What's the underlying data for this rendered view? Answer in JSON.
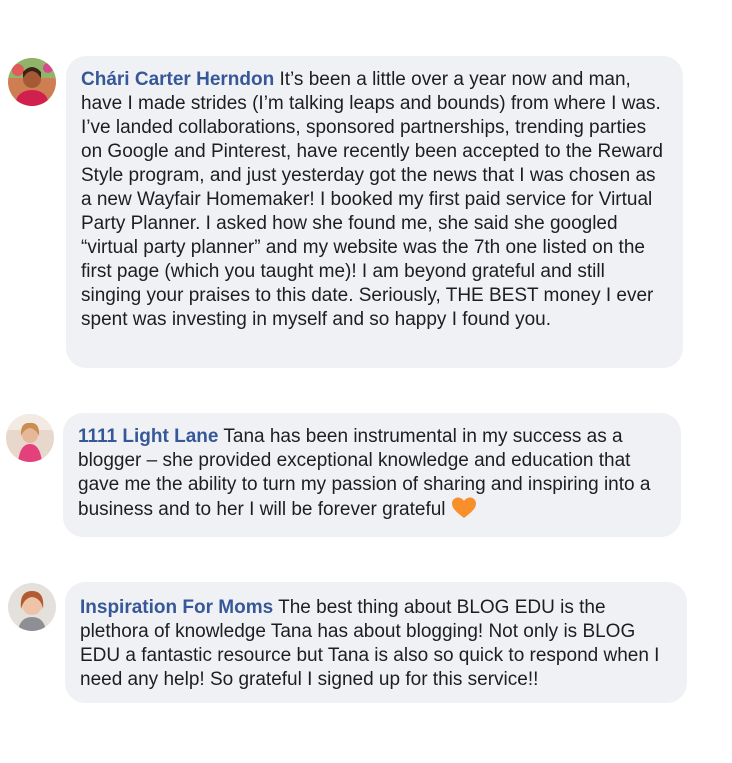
{
  "comments": [
    {
      "author": "Chári Carter Herndon",
      "text": "It’s been a little over a year now and man, have I made strides (I’m talking leaps and bounds) from where I was. I’ve landed collaborations, sponsored partnerships, trending parties on Google and Pinterest, have recently been accepted to the Reward Style program, and just yesterday got the news that I was chosen as a new Wayfair Homemaker! I booked my first paid service for Virtual Party Planner. I asked how she found me, she said she googled “virtual party planner” and my website was the 7th one listed on the first page (which you taught me)! I am beyond grateful and still singing your praises to this date. Seriously, THE BEST money I ever spent was investing in myself and so happy I found you.",
      "avatar_icon": "profile-photo-icon"
    },
    {
      "author": "1111 Light Lane",
      "text": "Tana has been instrumental in my success as a blogger – she provided exceptional knowledge and education that gave me the ability to turn my passion of sharing and inspiring into a business and to her I will be forever grateful",
      "emoji": "orange-heart-icon",
      "avatar_icon": "profile-photo-icon"
    },
    {
      "author": "Inspiration For Moms",
      "text": "The best thing about BLOG EDU is the plethora of knowledge Tana has about blogging! Not only is BLOG EDU a fantastic resource but Tana is also so quick to respond when I need any help! So grateful I signed up for this service!!",
      "avatar_icon": "profile-photo-icon"
    }
  ],
  "colors": {
    "bubble_background": "#f0f1f4",
    "author_name": "#365899",
    "body_text": "#1c1e21",
    "heart": "#f7902a"
  }
}
